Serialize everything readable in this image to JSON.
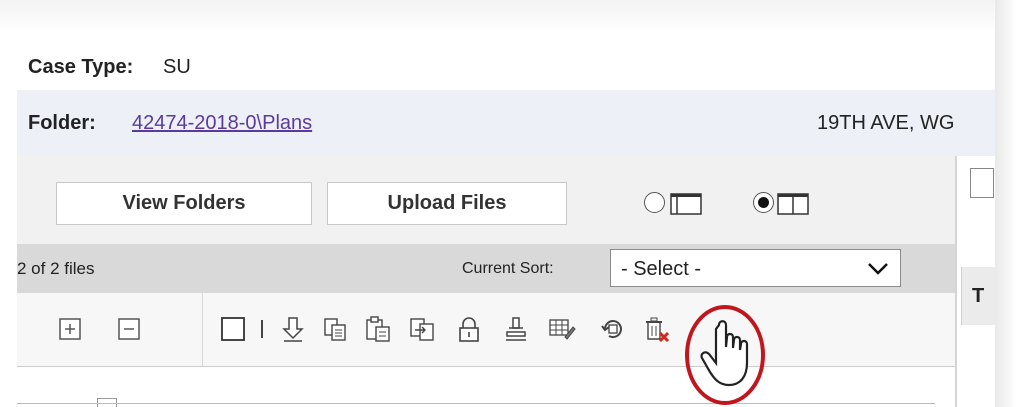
{
  "case": {
    "label": "Case Type:",
    "value": "SU"
  },
  "folder": {
    "label": "Folder:",
    "link": "42474-2018-0\\Plans",
    "address": "19TH AVE, WG"
  },
  "toolbar": {
    "view_folders": "View Folders",
    "upload_files": "Upload Files",
    "view_modes": [
      {
        "name": "single-pane-layout",
        "selected": false
      },
      {
        "name": "split-pane-layout",
        "selected": true
      }
    ]
  },
  "files": {
    "count": "2 of 2 files",
    "sort_label": "Current Sort:",
    "sort_value": "- Select -"
  },
  "right_panel": {
    "header": "T"
  },
  "actions": [
    "expand-all-icon",
    "collapse-all-icon",
    "select-all-checkbox",
    "download-icon",
    "copy-icon",
    "paste-icon",
    "move-icon",
    "lock-icon",
    "stamp-icon",
    "edit-grid-icon",
    "restore-icon",
    "delete-icon"
  ],
  "highlight": {
    "color": "#c0161d"
  }
}
